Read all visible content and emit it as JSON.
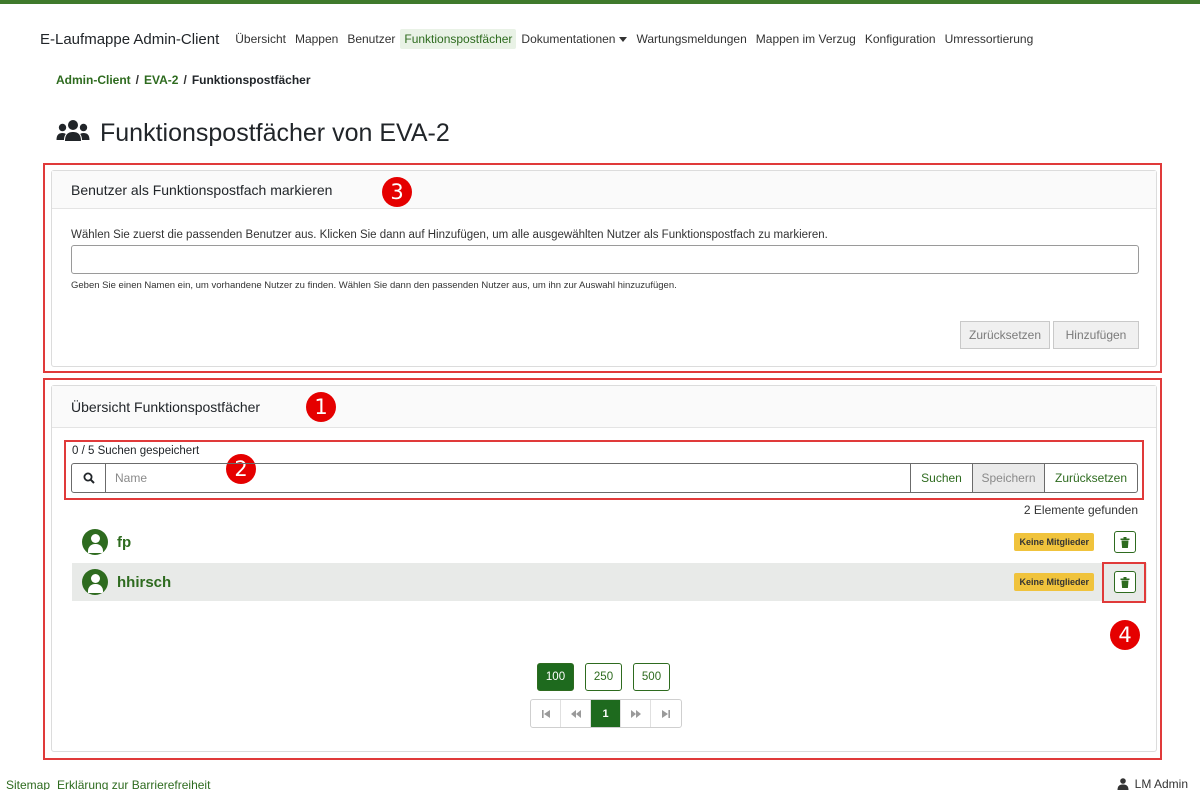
{
  "app": {
    "brand": "E-Laufmappe Admin-Client"
  },
  "nav": {
    "items": [
      {
        "label": "Übersicht"
      },
      {
        "label": "Mappen"
      },
      {
        "label": "Benutzer"
      },
      {
        "label": "Funktionspostfächer",
        "active": true
      },
      {
        "label": "Dokumentationen",
        "dropdown": true
      },
      {
        "label": "Wartungsmeldungen"
      },
      {
        "label": "Mappen im Verzug"
      },
      {
        "label": "Konfiguration"
      },
      {
        "label": "Umressortierung"
      }
    ]
  },
  "breadcrumb": {
    "items": [
      "Admin-Client",
      "EVA-2",
      "Funktionspostfächer"
    ],
    "separator": "/"
  },
  "page": {
    "title": "Funktionspostfächer von EVA-2",
    "icon": "users-icon"
  },
  "mark_card": {
    "header": "Benutzer als Funktionspostfach markieren",
    "instruction": "Wählen Sie zuerst die passenden Benutzer aus. Klicken Sie dann auf Hinzufügen, um alle ausgewählten Nutzer als Funktionspostfach zu markieren.",
    "input_value": "",
    "help": "Geben Sie einen Namen ein, um vorhandene Nutzer zu finden. Wählen Sie dann den passenden Nutzer aus, um ihn zur Auswahl hinzuzufügen.",
    "reset_label": "Zurücksetzen",
    "add_label": "Hinzufügen"
  },
  "overview_card": {
    "header": "Übersicht Funktionspostfächer",
    "saved_searches": "0 / 5 Suchen gespeichert",
    "search": {
      "placeholder": "Name",
      "search_label": "Suchen",
      "save_label": "Speichern",
      "reset_label": "Zurücksetzen"
    },
    "found": "2 Elemente gefunden",
    "rows": [
      {
        "name": "fp",
        "badge": "Keine Mitglieder"
      },
      {
        "name": "hhirsch",
        "badge": "Keine Mitglieder"
      }
    ],
    "page_sizes": [
      "100",
      "250",
      "500"
    ],
    "active_page_size": "100",
    "pages": [
      "1"
    ],
    "current_page": "1"
  },
  "annotations": [
    "1",
    "2",
    "3",
    "4"
  ],
  "footer": {
    "links": [
      "Sitemap",
      "Erklärung zur Barrierefreiheit"
    ],
    "user": "LM Admin"
  },
  "colors": {
    "accent": "#2e6b1f",
    "active_button": "#1e6a1e",
    "badge": "#f0c33c",
    "annotation": "#e50000"
  }
}
